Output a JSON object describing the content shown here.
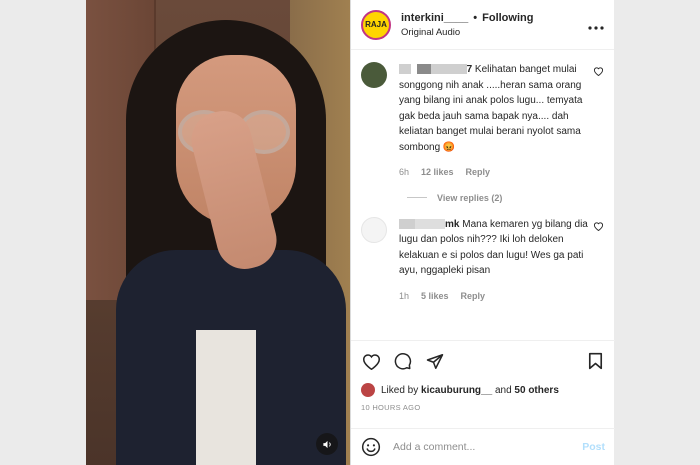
{
  "post": {
    "username": "interkini____",
    "separator": "•",
    "follow_status": "Following",
    "audio": "Original Audio",
    "avatar_text": "RAJA"
  },
  "comments": [
    {
      "username_suffix": "7",
      "text": "Kelihatan banget mulai songgong nih anak .....heran sama orang yang bilang ini anak polos lugu... temyata gak beda jauh sama bapak nya.... dah keliatan banget mulai berani nyolot sama sombong 😡",
      "time": "6h",
      "likes": "12 likes",
      "reply_label": "Reply",
      "view_replies": "View replies (2)",
      "avatar_color": "#4a5a3a"
    },
    {
      "username_suffix": "mk",
      "text": "Mana kemaren yg bilang dia lugu dan polos nih??? Iki loh deloken kelakuan e si polos dan lugu! Wes ga pati ayu, nggapleki pisan",
      "time": "1h",
      "likes": "5 likes",
      "reply_label": "Reply",
      "avatar_color": "#f0f0f0"
    }
  ],
  "actions": {
    "liked_prefix": "Liked by",
    "liked_user": "kicauburung__",
    "liked_and": "and",
    "liked_count": "50 others",
    "time_ago": "10 HOURS AGO"
  },
  "composer": {
    "placeholder": "Add a comment...",
    "post_label": "Post"
  },
  "icons": {
    "more": "more-options-icon",
    "heart": "heart-icon",
    "comment": "comment-icon",
    "share": "share-icon",
    "bookmark": "bookmark-icon",
    "emoji": "emoji-icon",
    "sound": "sound-icon"
  }
}
